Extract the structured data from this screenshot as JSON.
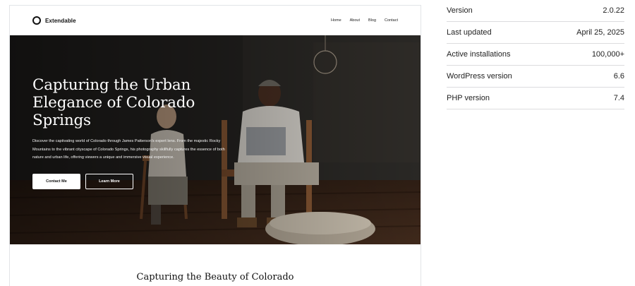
{
  "preview": {
    "brand": "Extendable",
    "nav": [
      "Home",
      "About",
      "Blog",
      "Contact"
    ],
    "hero": {
      "title": "Capturing the Urban Elegance of Colorado Springs",
      "description": "Discover the captivating world of Colorado through James Patterson's expert lens. From the majestic Rocky Mountains to the vibrant cityscape of Colorado Springs, his photography skillfully captures the essence of both nature and urban life, offering viewers a unique and immersive visual experience.",
      "primary_button": "Contact Me",
      "secondary_button": "Learn More"
    },
    "section_title": "Capturing the Beauty of Colorado"
  },
  "meta": [
    {
      "label": "Version",
      "value": "2.0.22"
    },
    {
      "label": "Last updated",
      "value": "April 25, 2025"
    },
    {
      "label": "Active installations",
      "value": "100,000+"
    },
    {
      "label": "WordPress version",
      "value": "6.6"
    },
    {
      "label": "PHP version",
      "value": "7.4"
    }
  ]
}
